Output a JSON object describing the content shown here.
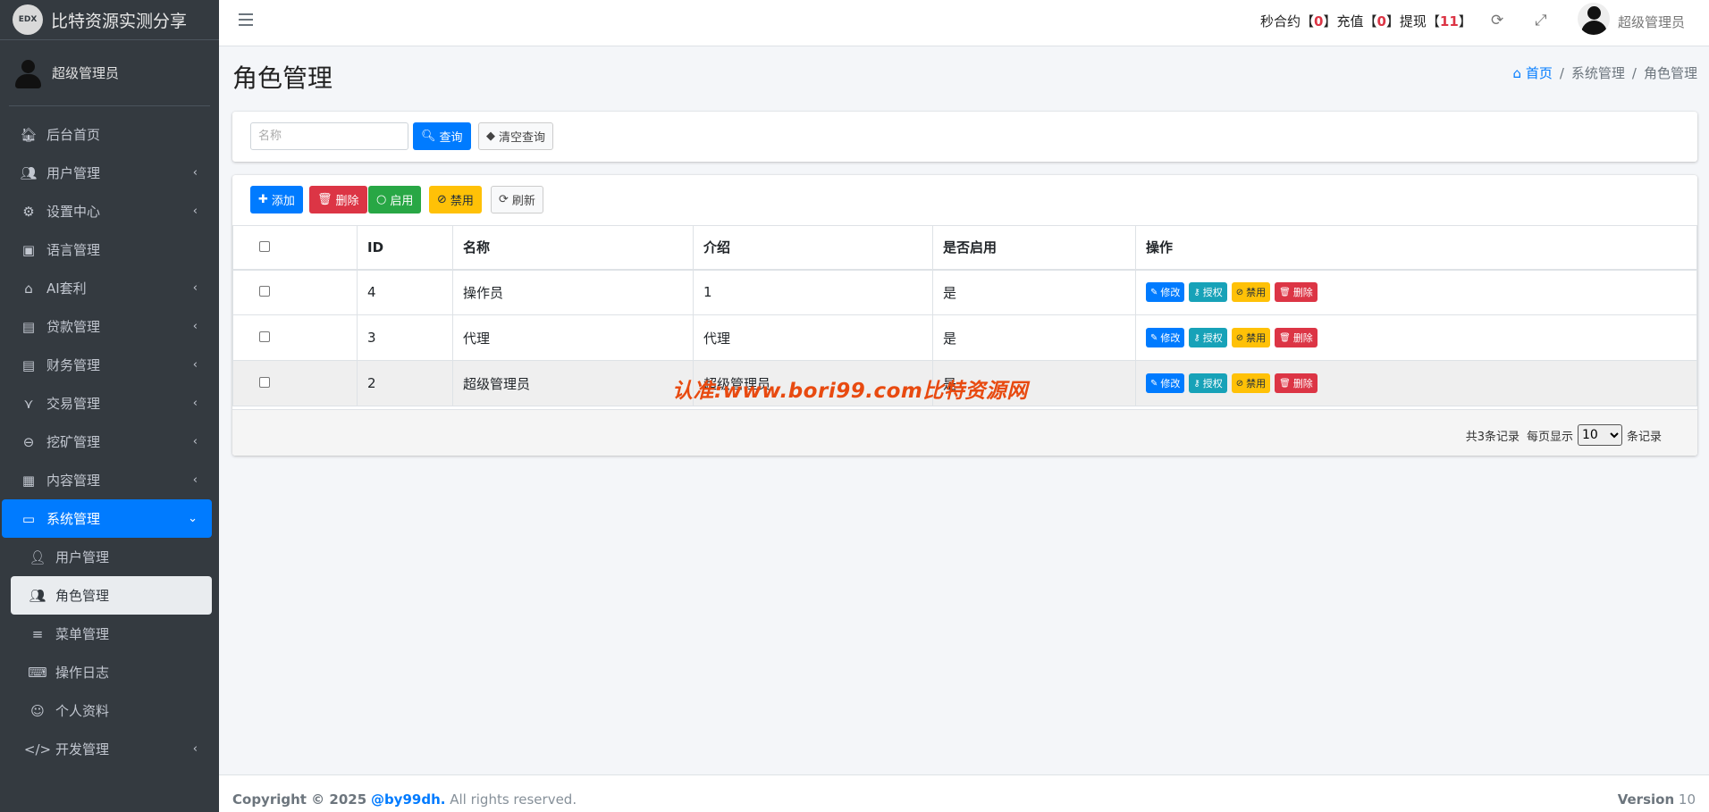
{
  "brand": {
    "logo_text": "EDX",
    "title": "比特资源实测分享"
  },
  "user": {
    "name": "超级管理员"
  },
  "sidebar": {
    "items": [
      {
        "label": "后台首页",
        "icon": "home-icon"
      },
      {
        "label": "用户管理",
        "icon": "users-icon"
      },
      {
        "label": "设置中心",
        "icon": "gears-icon"
      },
      {
        "label": "语言管理",
        "icon": "language-icon"
      },
      {
        "label": "AI套利",
        "icon": "android-icon"
      },
      {
        "label": "贷款管理",
        "icon": "money-icon"
      },
      {
        "label": "财务管理",
        "icon": "money-icon"
      },
      {
        "label": "交易管理",
        "icon": "sitemap-icon"
      },
      {
        "label": "挖矿管理",
        "icon": "search-minus-icon"
      },
      {
        "label": "内容管理",
        "icon": "newspaper-icon"
      },
      {
        "label": "系统管理",
        "icon": "desktop-icon"
      }
    ],
    "subitems": [
      {
        "label": "用户管理",
        "icon": "user-icon"
      },
      {
        "label": "角色管理",
        "icon": "users-icon"
      },
      {
        "label": "菜单管理",
        "icon": "list-icon"
      },
      {
        "label": "操作日志",
        "icon": "keyboard-icon"
      },
      {
        "label": "个人资料",
        "icon": "smile-icon"
      },
      {
        "label": "开发管理",
        "icon": "code-icon"
      }
    ]
  },
  "topbar": {
    "stats_label_1": "秒合约【",
    "stats_val_1": "0",
    "stats_label_2": "】充值【",
    "stats_val_2": "0",
    "stats_label_3": "】提现【",
    "stats_val_3": "11",
    "stats_end": "】",
    "user_name": "超级管理员"
  },
  "page": {
    "title": "角色管理",
    "breadcrumb": {
      "home": "首页",
      "parent": "系统管理",
      "current": "角色管理"
    }
  },
  "search": {
    "placeholder": "名称",
    "query_label": "查询",
    "clear_label": "清空查询"
  },
  "toolbar": {
    "add": "添加",
    "delete": "删除",
    "enable": "启用",
    "disable": "禁用",
    "refresh": "刷新"
  },
  "table": {
    "headers": {
      "id": "ID",
      "name": "名称",
      "intro": "介绍",
      "enabled": "是否启用",
      "ops": "操作"
    },
    "rows": [
      {
        "id": "4",
        "name": "操作员",
        "intro": "1",
        "enabled": "是"
      },
      {
        "id": "3",
        "name": "代理",
        "intro": "代理",
        "enabled": "是"
      },
      {
        "id": "2",
        "name": "超级管理员",
        "intro": "超级管理员",
        "enabled": "是"
      }
    ],
    "row_actions": {
      "edit": "修改",
      "auth": "授权",
      "disable": "禁用",
      "delete": "删除"
    }
  },
  "pager": {
    "total": "共3条记录",
    "per_page_label": "每页显示",
    "per_page_value": "10",
    "records_label": "条记录"
  },
  "watermark": "认准:www.bori99.com比特资源网",
  "footer": {
    "copyright": "Copyright © 2025",
    "brand_link": "@by99dh.",
    "rights": "All rights reserved.",
    "version_label": "Version",
    "version_value": "10"
  },
  "colors": {
    "primary": "#007bff",
    "danger": "#dc3545",
    "success": "#28a745",
    "warning": "#ffc107",
    "info": "#17a2b8",
    "sidebar_bg": "#343a40"
  }
}
